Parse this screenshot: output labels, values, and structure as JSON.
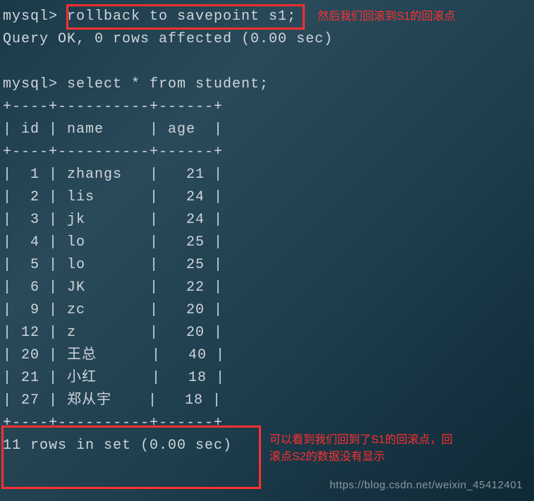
{
  "prompt": "mysql> ",
  "command1": "rollback to savepoint s1;",
  "result1": "Query OK, 0 rows affected (0.00 sec)",
  "command2": "select * from student;",
  "table": {
    "border_top": "+----+----------+------+",
    "header": "| id | name     | age  |",
    "border_mid": "+----+----------+------+",
    "rows": [
      "|  1 | zhangs   |   21 |",
      "|  2 | lis      |   24 |",
      "|  3 | jk       |   24 |",
      "|  4 | lo       |   25 |",
      "|  5 | lo       |   25 |",
      "|  6 | JK       |   22 |",
      "|  9 | zc       |   20 |",
      "| 12 | z        |   20 |",
      "| 20 | 王总      |   40 |",
      "| 21 | 小红      |   18 |",
      "| 27 | 郑从宇    |   18 |"
    ],
    "border_bot": "+----+----------+------+"
  },
  "result2": "11 rows in set (0.00 sec)",
  "annot1": "然后我们回滚到S1的回滚点",
  "annot2_line1": "可以看到我们回到了S1的回滚点，回",
  "annot2_line2": "滚点S2的数据没有显示",
  "watermark": "https://blog.csdn.net/weixin_45412401",
  "chart_data": {
    "type": "table",
    "title": "student",
    "columns": [
      "id",
      "name",
      "age"
    ],
    "rows": [
      {
        "id": 1,
        "name": "zhangs",
        "age": 21
      },
      {
        "id": 2,
        "name": "lis",
        "age": 24
      },
      {
        "id": 3,
        "name": "jk",
        "age": 24
      },
      {
        "id": 4,
        "name": "lo",
        "age": 25
      },
      {
        "id": 5,
        "name": "lo",
        "age": 25
      },
      {
        "id": 6,
        "name": "JK",
        "age": 22
      },
      {
        "id": 9,
        "name": "zc",
        "age": 20
      },
      {
        "id": 12,
        "name": "z",
        "age": 20
      },
      {
        "id": 20,
        "name": "王总",
        "age": 40
      },
      {
        "id": 21,
        "name": "小红",
        "age": 18
      },
      {
        "id": 27,
        "name": "郑从宇",
        "age": 18
      }
    ]
  }
}
